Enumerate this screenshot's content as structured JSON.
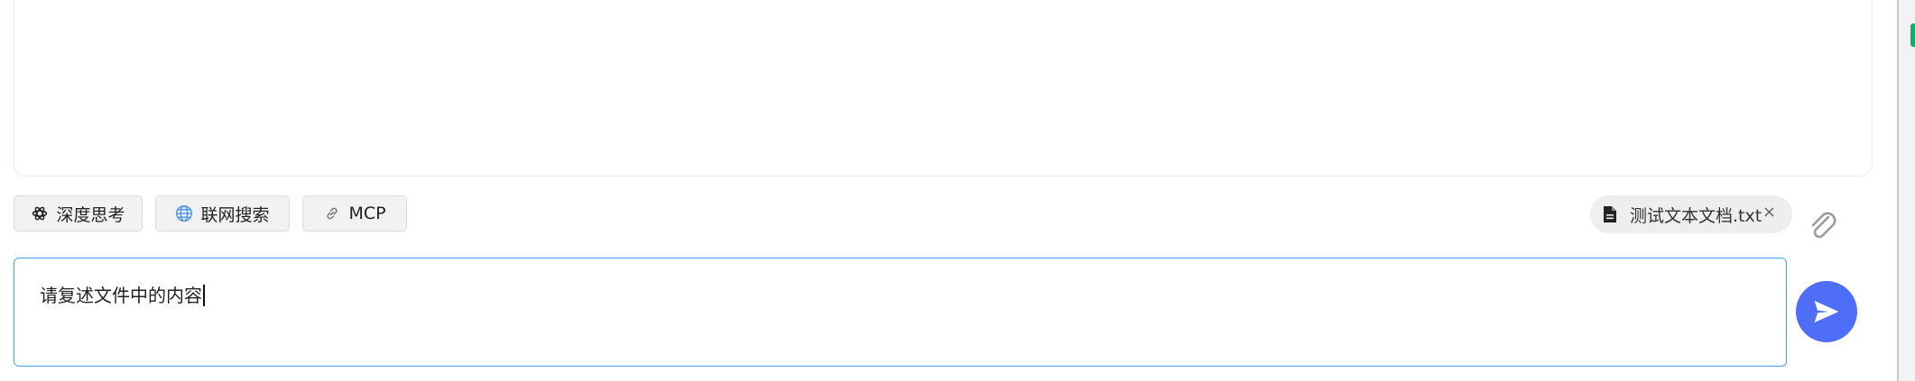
{
  "toolbar": {
    "deep_think_label": "深度思考",
    "web_search_label": "联网搜索",
    "mcp_label": "MCP"
  },
  "attachment": {
    "file_name": "测试文本文档.txt",
    "close_symbol": "×"
  },
  "input": {
    "value": "请复述文件中的内容"
  },
  "icons": {
    "deep_think": "atom-icon",
    "web_search": "globe-icon",
    "mcp": "link-icon",
    "file": "document-icon",
    "attach": "paperclip-icon",
    "send": "send-icon"
  },
  "colors": {
    "input_border": "#409eff",
    "send_button": "#4f6ef7",
    "chip_background": "#f2f2f2"
  }
}
